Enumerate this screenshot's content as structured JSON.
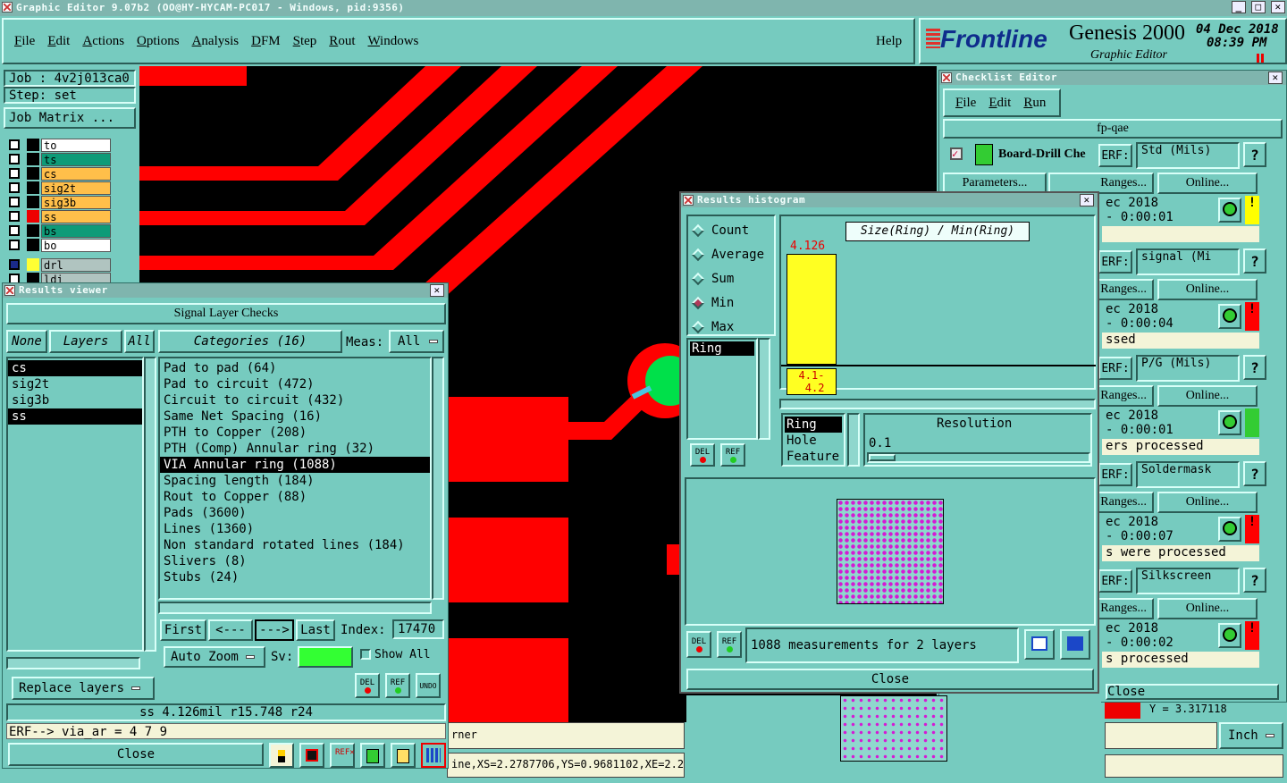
{
  "window": {
    "title": "Graphic Editor 9.07b2 (OO@HY-HYCAM-PC017 - Windows, pid:9356)"
  },
  "menu": [
    "File",
    "Edit",
    "Actions",
    "Options",
    "Analysis",
    "DFM",
    "Step",
    "Rout",
    "Windows"
  ],
  "help": "Help",
  "brand": {
    "logo": "Frontline",
    "product": "Genesis 2000",
    "subtitle": "Graphic Editor",
    "date": "04 Dec 2018",
    "time": "08:39 PM"
  },
  "job": {
    "job": "Job : 4v2j013ca0",
    "step": "Step: set",
    "matrix": "Job Matrix ..."
  },
  "layers": [
    {
      "name": "to",
      "color": "#ffffff"
    },
    {
      "name": "ts",
      "color": "#0e9b78"
    },
    {
      "name": "cs",
      "color": "#ffbf4a"
    },
    {
      "name": "sig2t",
      "color": "#ffbf4a"
    },
    {
      "name": "sig3b",
      "color": "#ffbf4a"
    },
    {
      "name": "ss",
      "color": "#ffbf4a"
    },
    {
      "name": "bs",
      "color": "#0e9b78"
    },
    {
      "name": "bo",
      "color": "#ffffff"
    },
    {
      "name": "drl",
      "color": "#b0c4c0"
    },
    {
      "name": "ldi",
      "color": "#b0c4c0"
    }
  ],
  "results_viewer": {
    "title": "Results viewer",
    "header": "Signal Layer Checks",
    "none": "None",
    "layers_btn": "Layers",
    "all": "All",
    "categories_btn": "Categories (16)",
    "meas_label": "Meas:",
    "meas_value": "All",
    "layer_list": [
      "cs",
      "sig2t",
      "sig3b",
      "ss"
    ],
    "categories": [
      "Pad to pad (64)",
      "Pad to circuit (472)",
      "Circuit to circuit (432)",
      "Same Net Spacing (16)",
      "PTH to Copper (208)",
      "PTH (Comp) Annular ring (32)",
      "VIA Annular ring (1088)",
      "Spacing length (184)",
      "Rout to Copper (88)",
      "Pads (3600)",
      "Lines (1360)",
      "Non standard rotated lines (184)",
      "Slivers (8)",
      "Stubs (24)"
    ],
    "first": "First",
    "prev": "<---",
    "next": "--->",
    "last": "Last",
    "index_label": "Index:",
    "index_value": "17470",
    "auto_zoom": "Auto Zoom",
    "sv_label": "Sv:",
    "show_all": "Show All",
    "replace_layers": "Replace layers",
    "status": "ss 4.126mil  r15.748  r24",
    "erf": "ERF--> via_ar = 4 7 9",
    "close": "Close",
    "del": "DEL",
    "ref": "REF",
    "undo": "UNDO"
  },
  "histogram": {
    "title": "Results histogram",
    "options": [
      "Count",
      "Average",
      "Sum",
      "Min",
      "Max"
    ],
    "selected": "Min",
    "left_list": [
      "Ring"
    ],
    "chart_title": "Size(Ring) / Min(Ring)",
    "bar_value": "4.126",
    "bar_range": "4.1-\n 4.2",
    "types": [
      "Ring",
      "Hole",
      "Feature"
    ],
    "resolution_label": "Resolution",
    "resolution_value": "0.1",
    "measurements": "1088 measurements for 2 layers",
    "close": "Close",
    "del": "DEL",
    "ref": "REF"
  },
  "checklist": {
    "title": "Checklist Editor",
    "menu": [
      "File",
      "Edit",
      "Run"
    ],
    "name": "fp-qae",
    "first_row": "Board-Drill Che",
    "erf": "ERF:",
    "rows": [
      {
        "erf_value": "Std (Mils)",
        "date": "ec 2018",
        "dur": "- 0:00:01",
        "status": "",
        "flag": "#ffff00"
      },
      {
        "erf_value": "signal (Mi",
        "date": "ec 2018",
        "dur": "- 0:00:04",
        "status": "ssed",
        "flag": "#ff0000"
      },
      {
        "erf_value": "P/G (Mils)",
        "date": "ec 2018",
        "dur": "- 0:00:01",
        "status": "ers processed",
        "flag": "#33cc33"
      },
      {
        "erf_value": "Soldermask",
        "date": "ec 2018",
        "dur": "- 0:00:07",
        "status": "s were processed",
        "flag": "#ff0000"
      },
      {
        "erf_value": "Silkscreen",
        "date": "ec 2018",
        "dur": "- 0:00:02",
        "status": "s processed",
        "flag": "#ff0000"
      }
    ],
    "parameters": "Parameters...",
    "ranges": "Ranges...",
    "online": "Online...",
    "close": "Close"
  },
  "bottom": {
    "corner": "rner",
    "coords": "ine,XS=2.2787706,YS=0.9681102,XE=2.27",
    "unit": "Inch",
    "ytext": "Y = 3.317118"
  }
}
